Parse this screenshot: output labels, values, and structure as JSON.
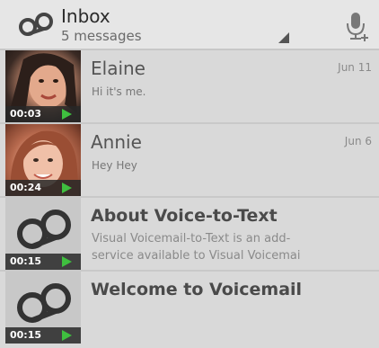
{
  "header": {
    "title": "Inbox",
    "subtitle": "5 messages",
    "logo_icon": "voicemail-icon",
    "mic_icon": "mic-add-icon",
    "overflow_icon": "corner-triangle-icon"
  },
  "messages": [
    {
      "name": "Elaine",
      "preview": "Hi it's me.",
      "date": "Jun 11",
      "duration": "00:03",
      "thumbnail": "photo"
    },
    {
      "name": "Annie",
      "preview": "Hey Hey",
      "date": "Jun 6",
      "duration": "00:24",
      "thumbnail": "photo"
    },
    {
      "name": "About Voice-to-Text",
      "preview_line1": "Visual Voicemail-to-Text is an add-",
      "preview_line2": "service available to Visual Voicemai",
      "date": "",
      "duration": "00:15",
      "thumbnail": "voicemail-icon"
    },
    {
      "name": "Welcome to Voicemail",
      "preview": "",
      "date": "",
      "duration": "00:15",
      "thumbnail": "voicemail-icon"
    }
  ],
  "colors": {
    "background": "#d9d9d9",
    "header": "#e6e6e6",
    "play": "#3fbf3f"
  }
}
